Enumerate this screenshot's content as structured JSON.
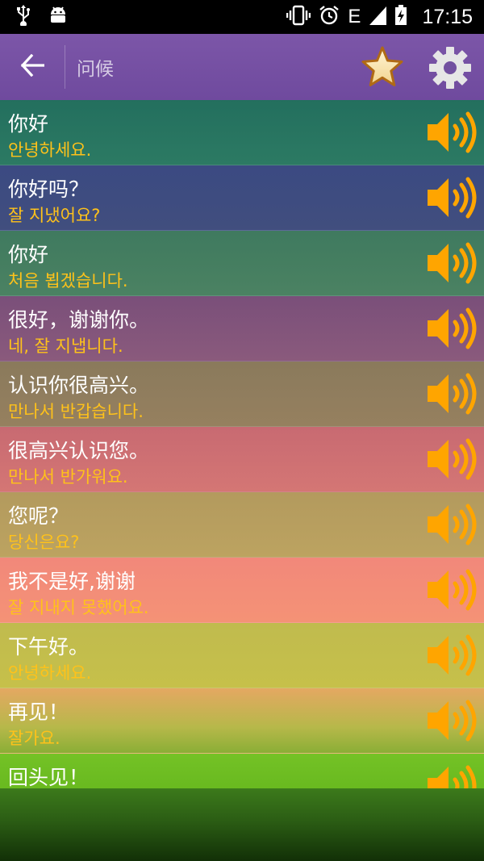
{
  "status_bar": {
    "time": "17:15",
    "network": "E",
    "icons": [
      "usb-icon",
      "android-icon",
      "vibrate-icon",
      "alarm-icon",
      "signal-icon",
      "battery-charging-icon"
    ]
  },
  "app_bar": {
    "title": "问候",
    "back_icon": "arrow-left-icon",
    "favorite_icon": "star-icon",
    "settings_icon": "gear-icon"
  },
  "colors": {
    "app_bar": "#7a54a6",
    "korean_text": "#ffc21a",
    "speaker": "#ffa500"
  },
  "phrases": [
    {
      "chinese": "你好",
      "korean": "안녕하세요."
    },
    {
      "chinese": "你好吗？",
      "korean": "잘 지냈어요?"
    },
    {
      "chinese": "你好",
      "korean": "처음 뵙겠습니다."
    },
    {
      "chinese": "很好，谢谢你。",
      "korean": "네, 잘 지냅니다."
    },
    {
      "chinese": "认识你很高兴。",
      "korean": "만나서 반갑습니다."
    },
    {
      "chinese": "很高兴认识您。",
      "korean": "만나서 반가워요."
    },
    {
      "chinese": "您呢？",
      "korean": "당신은요?"
    },
    {
      "chinese": "我不是好,谢谢",
      "korean": "잘 지내지 못했어요."
    },
    {
      "chinese": "下午好。",
      "korean": "안녕하세요."
    },
    {
      "chinese": "再见！",
      "korean": "잘가요."
    },
    {
      "chinese": "回头见！",
      "korean": ""
    }
  ]
}
